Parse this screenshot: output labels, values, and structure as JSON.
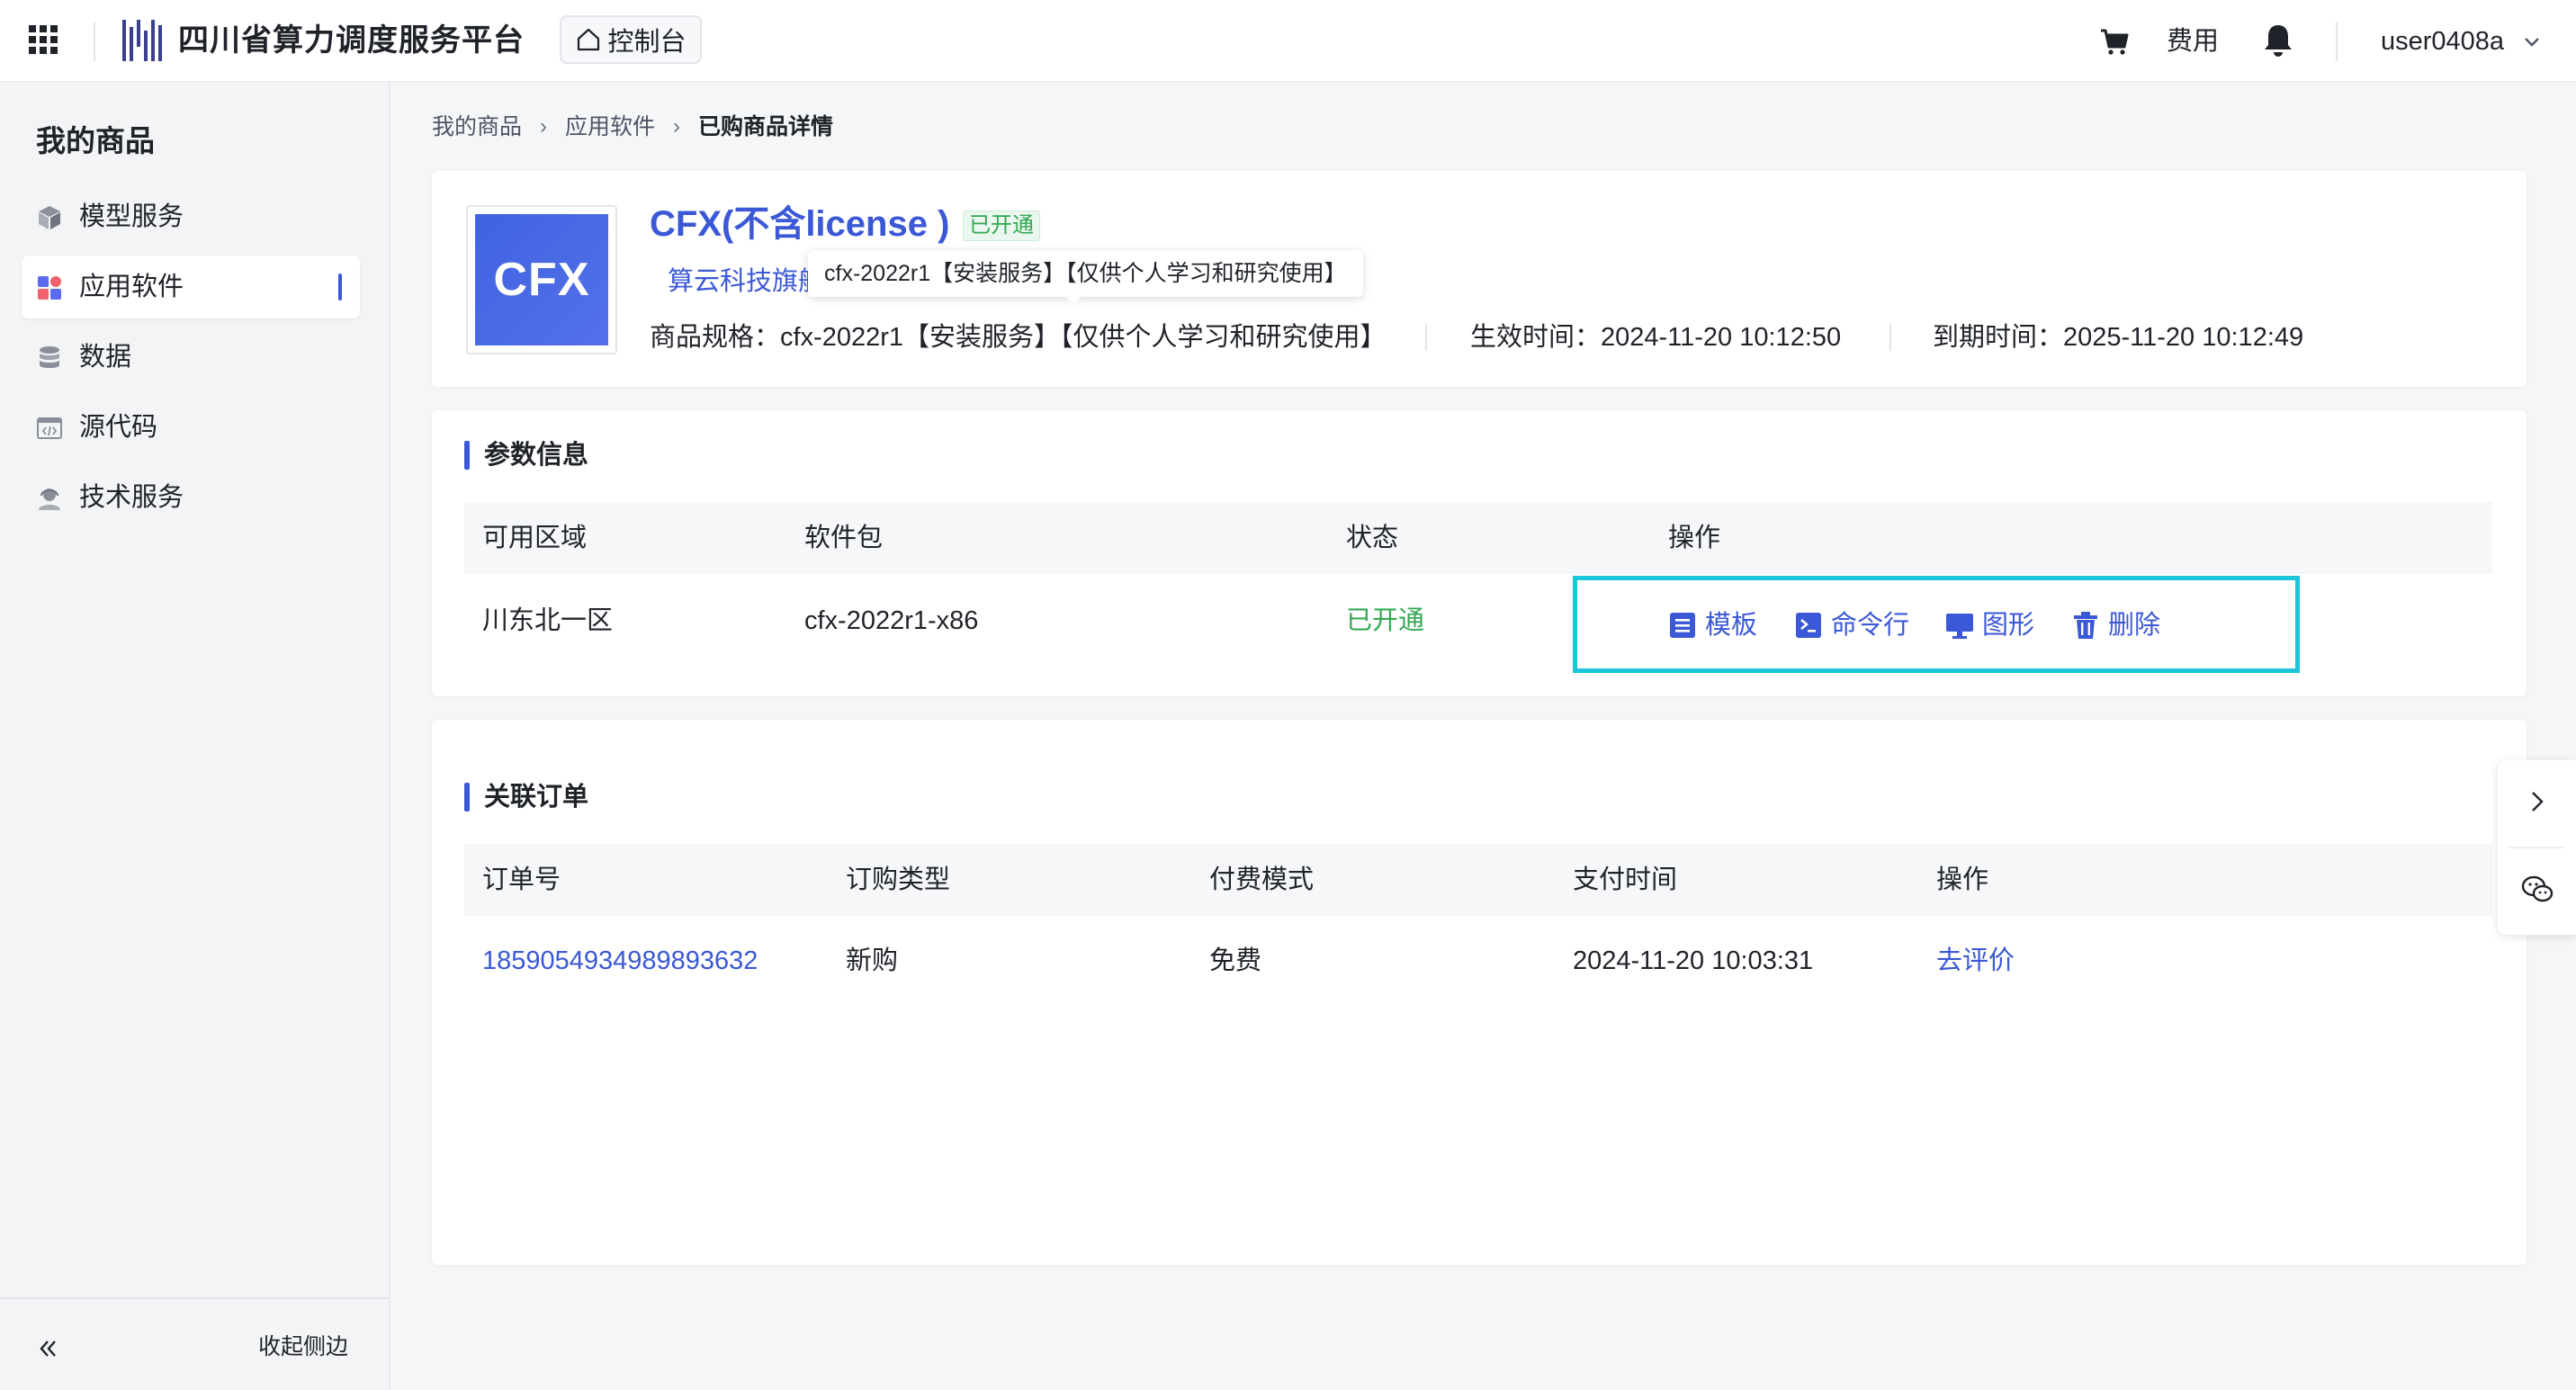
{
  "topbar": {
    "platform_title": "四川省算力调度服务平台",
    "console_label": "控制台",
    "fee_label": "费用",
    "username": "user0408a"
  },
  "sidebar": {
    "title": "我的商品",
    "items": [
      {
        "label": "模型服务",
        "icon": "cube-icon"
      },
      {
        "label": "应用软件",
        "icon": "apps-icon",
        "active": true
      },
      {
        "label": "数据",
        "icon": "database-icon"
      },
      {
        "label": "源代码",
        "icon": "code-icon"
      },
      {
        "label": "技术服务",
        "icon": "support-person-icon"
      }
    ],
    "collapse_label": "收起侧边"
  },
  "breadcrumb": [
    "我的商品",
    "应用软件",
    "已购商品详情"
  ],
  "product": {
    "logo_text": "CFX",
    "name": "CFX(不含license )",
    "status": "已开通",
    "vendor": "算云科技旗舰",
    "tooltip": "cfx-2022r1【安装服务】【仅供个人学习和研究使用】",
    "spec": "商品规格：cfx-2022r1【安装服务】【仅供个人学习和研究使用】",
    "effective_time": "生效时间：2024-11-20 10:12:50",
    "expire_time": "到期时间：2025-11-20 10:12:49"
  },
  "params": {
    "title": "参数信息",
    "headers": [
      "可用区域",
      "软件包",
      "状态",
      "操作"
    ],
    "row": {
      "region": "川东北一区",
      "package": "cfx-2022r1-x86",
      "status": "已开通"
    },
    "actions": [
      {
        "label": "模板",
        "icon": "template-icon"
      },
      {
        "label": "命令行",
        "icon": "terminal-icon"
      },
      {
        "label": "图形",
        "icon": "monitor-icon"
      },
      {
        "label": "删除",
        "icon": "trash-icon"
      }
    ]
  },
  "orders": {
    "title": "关联订单",
    "headers": [
      "订单号",
      "订购类型",
      "付费模式",
      "支付时间",
      "操作"
    ],
    "rows": [
      {
        "order_no": "1859054934989893632",
        "type": "新购",
        "pay_mode": "免费",
        "pay_time": "2024-11-20 10:03:31",
        "action": "去评价"
      }
    ]
  },
  "colors": {
    "accent": "#3b58d6",
    "success": "#34a853",
    "highlight_box": "#1bc6d8"
  }
}
